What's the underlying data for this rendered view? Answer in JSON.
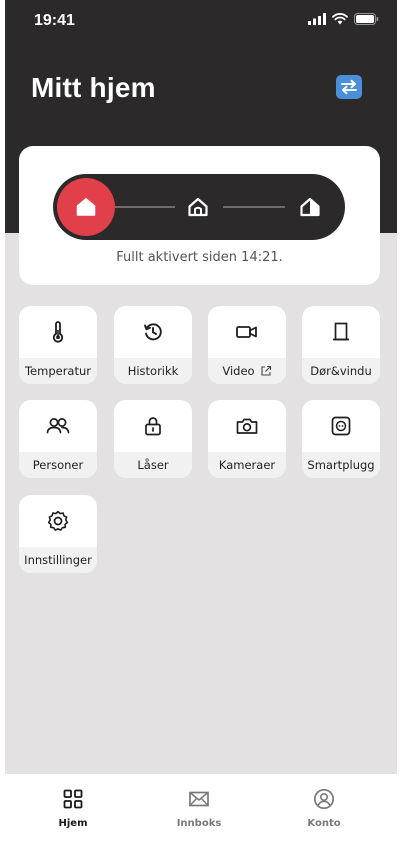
{
  "status_bar": {
    "time": "19:41"
  },
  "header": {
    "title": "Mitt hjem"
  },
  "alarm": {
    "status_text": "Fullt aktivert siden 14:21.",
    "accent_color": "#e1404a",
    "modes": [
      "fully-armed-home-icon",
      "home-outline-icon",
      "home-half-icon"
    ]
  },
  "tiles": [
    {
      "label": "Temperatur",
      "icon": "thermometer-icon"
    },
    {
      "label": "Historikk",
      "icon": "history-icon"
    },
    {
      "label": "Video",
      "icon": "video-camera-icon",
      "external": true
    },
    {
      "label": "Dør&vindu",
      "icon": "door-icon"
    },
    {
      "label": "Personer",
      "icon": "people-icon"
    },
    {
      "label": "Låser",
      "icon": "lock-icon"
    },
    {
      "label": "Kameraer",
      "icon": "camera-icon"
    },
    {
      "label": "Smartplugg",
      "icon": "smartplug-icon"
    },
    {
      "label": "Innstillinger",
      "icon": "gear-icon"
    }
  ],
  "tab_bar": {
    "items": [
      {
        "label": "Hjem",
        "icon": "grid-icon",
        "active": true
      },
      {
        "label": "Innboks",
        "icon": "envelope-icon",
        "active": false
      },
      {
        "label": "Konto",
        "icon": "account-icon",
        "active": false
      }
    ]
  }
}
